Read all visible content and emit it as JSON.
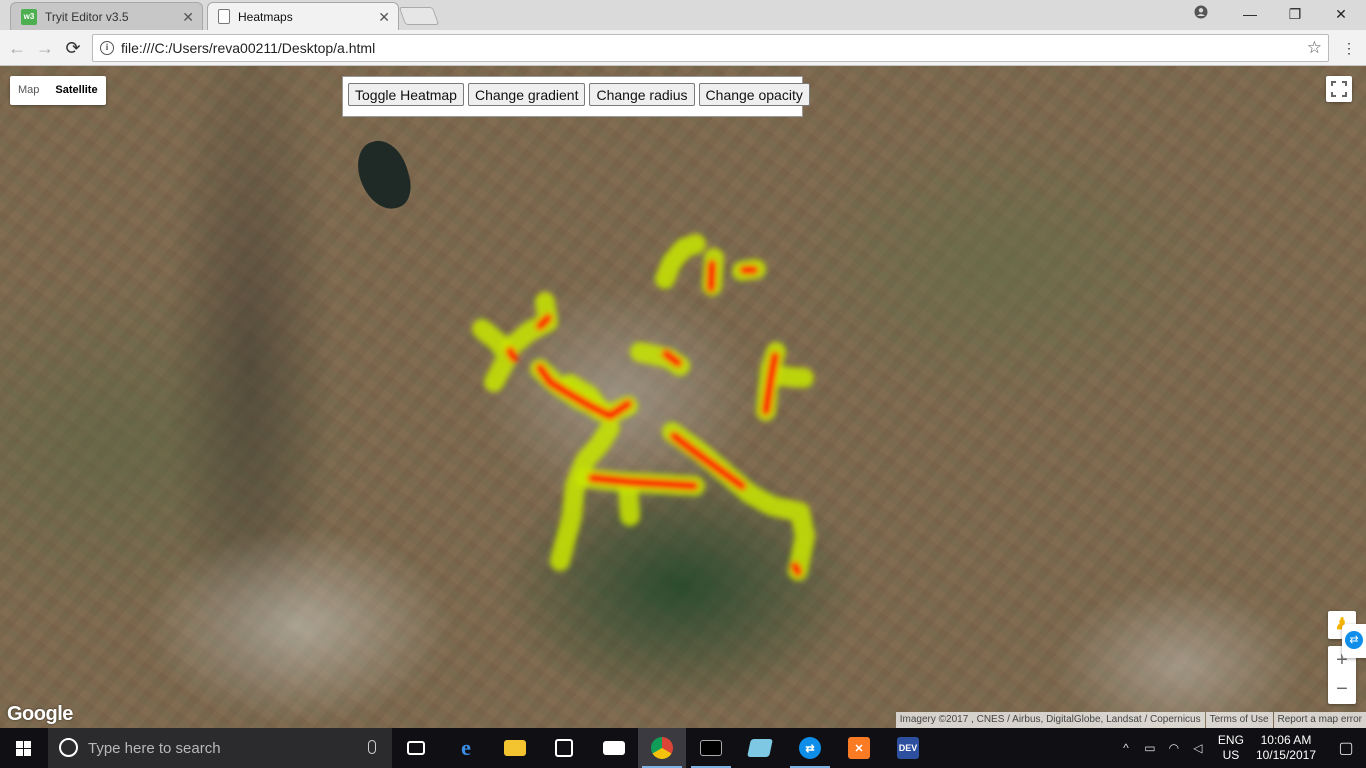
{
  "browser": {
    "tabs": [
      {
        "title": "Tryit Editor v3.5",
        "favicon": "w3schools-icon"
      },
      {
        "title": "Heatmaps",
        "favicon": "page-icon"
      }
    ],
    "url": "file:///C:/Users/reva00211/Desktop/a.html"
  },
  "map": {
    "map_type_options": [
      "Map",
      "Satellite"
    ],
    "selected_map_type": "Satellite",
    "controls": {
      "toggle_heatmap": "Toggle Heatmap",
      "change_gradient": "Change gradient",
      "change_radius": "Change radius",
      "change_opacity": "Change opacity"
    },
    "zoom_in": "+",
    "zoom_out": "−",
    "logo": "Google",
    "attribution": {
      "imagery": "Imagery ©2017 , CNES / Airbus, DigitalGlobe, Landsat / Copernicus",
      "terms": "Terms of Use",
      "report": "Report a map error"
    },
    "heatmap_colors": [
      "#c8e600",
      "#ff0000"
    ]
  },
  "taskbar": {
    "search_placeholder": "Type here to search",
    "apps": [
      "task-view-icon",
      "edge-icon",
      "file-explorer-icon",
      "store-icon",
      "mail-icon",
      "chrome-icon",
      "cmd-icon",
      "notepad-icon",
      "teamviewer-icon",
      "xampp-icon",
      "devcpp-icon"
    ],
    "language": {
      "line1": "ENG",
      "line2": "US"
    },
    "clock": {
      "time": "10:06 AM",
      "date": "10/15/2017"
    }
  }
}
